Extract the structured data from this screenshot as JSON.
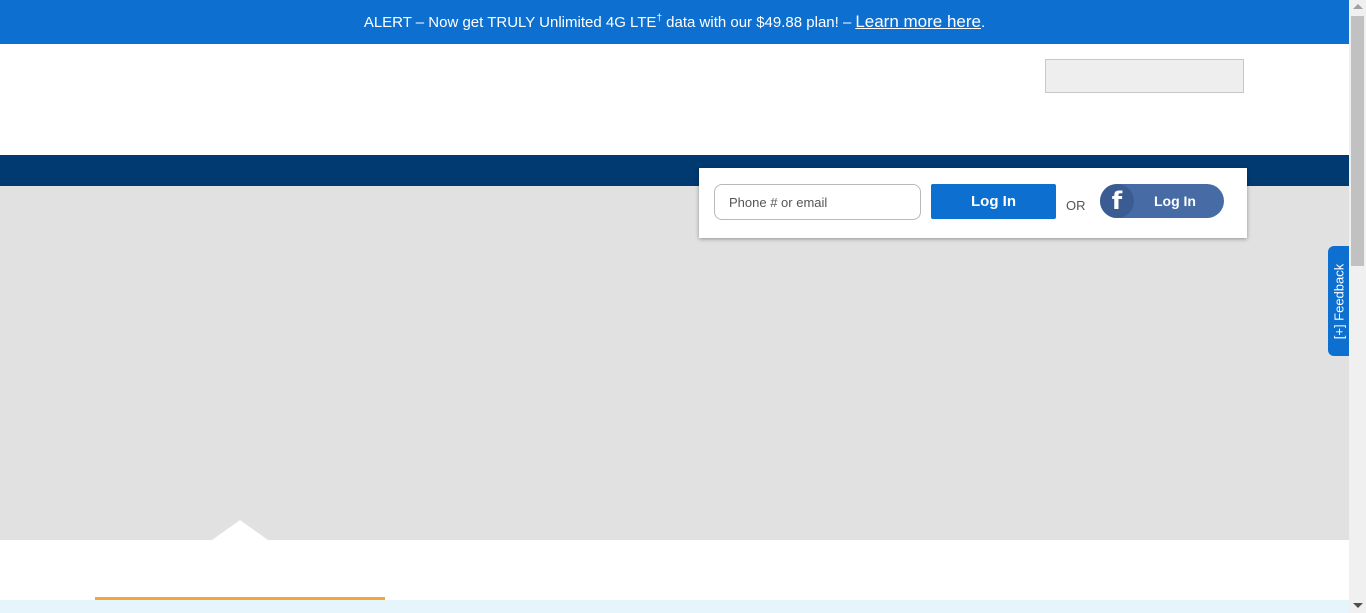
{
  "alert": {
    "text_before": "ALERT – Now get TRULY Unlimited 4G LTE",
    "dagger": "†",
    "text_after": " data with our $49.88 plan! –",
    "link_text": "Learn more here",
    "period": "."
  },
  "login": {
    "input_placeholder": "Phone # or email",
    "login_button": "Log In",
    "or_text": "OR",
    "facebook_icon_glyph": "f",
    "facebook_login_button": "Log In"
  },
  "feedback_tab": {
    "label": "[+] Feedback"
  },
  "colors": {
    "alert_bg": "#0d6fd0",
    "nav_bg": "#003a70",
    "hero_bg": "#e1e1e1",
    "facebook": "#476ba5",
    "accent_orange": "#f6a53a"
  }
}
